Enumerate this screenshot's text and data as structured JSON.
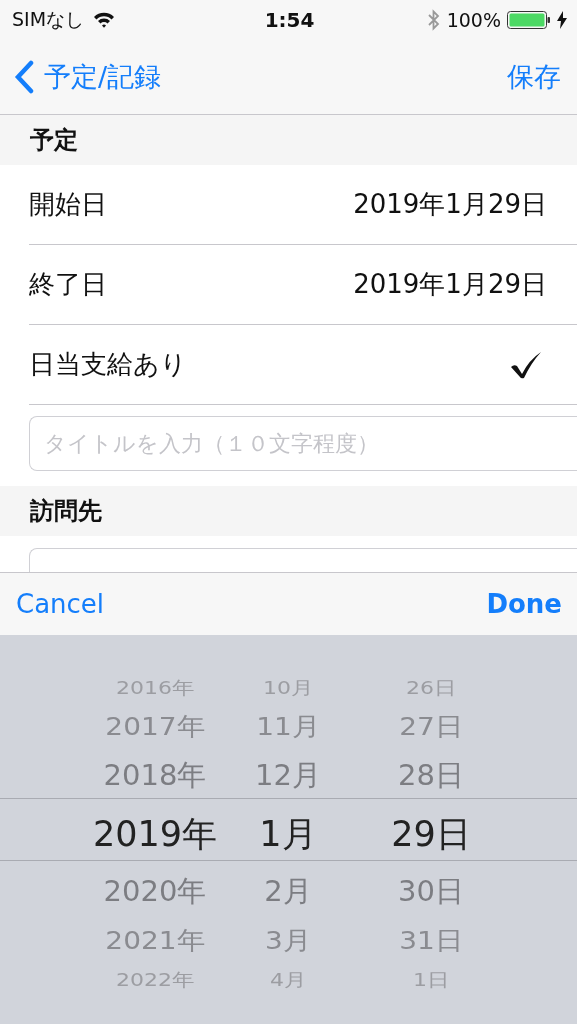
{
  "status_bar": {
    "carrier": "SIMなし",
    "time": "1:54",
    "battery_percent": "100%",
    "charging": true
  },
  "nav": {
    "back_label": "予定/記録",
    "action": "保存"
  },
  "sections": [
    {
      "header": "予定",
      "rows": [
        {
          "kind": "value",
          "label": "開始日",
          "value": "2019年1月29日"
        },
        {
          "kind": "value",
          "label": "終了日",
          "value": "2019年1月29日"
        },
        {
          "kind": "check",
          "label": "日当支給あり",
          "checked": true
        },
        {
          "kind": "field",
          "placeholder": "タイトルを入力（１０文字程度）"
        }
      ]
    },
    {
      "header": "訪問先",
      "rows": [
        {
          "kind": "field"
        }
      ]
    }
  ],
  "toolbar": {
    "cancel": "Cancel",
    "done": "Done"
  },
  "picker": {
    "columns": [
      {
        "items": [
          {
            "label": "2016年",
            "selected": false
          },
          {
            "label": "2017年",
            "selected": false
          },
          {
            "label": "2018年",
            "selected": false
          },
          {
            "label": "2019年",
            "selected": true
          },
          {
            "label": "2020年",
            "selected": false
          },
          {
            "label": "2021年",
            "selected": false
          },
          {
            "label": "2022年",
            "selected": false
          }
        ]
      },
      {
        "items": [
          {
            "label": "10月",
            "selected": false
          },
          {
            "label": "11月",
            "selected": false
          },
          {
            "label": "12月",
            "selected": false
          },
          {
            "label": "1月",
            "selected": true
          },
          {
            "label": "2月",
            "selected": false
          },
          {
            "label": "3月",
            "selected": false
          },
          {
            "label": "4月",
            "selected": false
          }
        ]
      },
      {
        "items": [
          {
            "label": "26日",
            "selected": false
          },
          {
            "label": "27日",
            "selected": false
          },
          {
            "label": "28日",
            "selected": false
          },
          {
            "label": "29日",
            "selected": true
          },
          {
            "label": "30日",
            "selected": false
          },
          {
            "label": "31日",
            "selected": false
          },
          {
            "label": "1日",
            "selected": false
          }
        ]
      }
    ]
  }
}
